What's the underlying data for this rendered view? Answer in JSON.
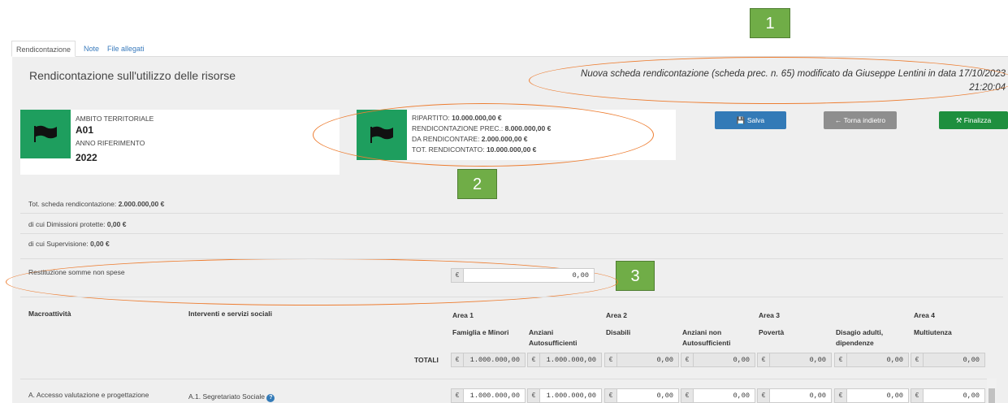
{
  "tabs": [
    "Rendicontazione",
    "Note",
    "File allegati"
  ],
  "page_title": "Rendicontazione sull'utilizzo delle risorse",
  "subtitle_line1": "Nuova scheda rendicontazione (scheda prec. n. 65) modificato da Giuseppe Lentini in data 17/10/2023",
  "subtitle_line2": "21:20:04",
  "card1": {
    "label1": "AMBITO TERRITORIALE",
    "value1": "A01",
    "label2": "ANNO RIFERIMENTO",
    "value2": "2022"
  },
  "card2": {
    "ripartito_label": "RIPARTITO: ",
    "ripartito_value": "10.000.000,00 €",
    "prec_label": "RENDICONTAZIONE PREC.: ",
    "prec_value": "8.000.000,00 €",
    "da_label": "DA RENDICONTARE: ",
    "da_value": "2.000.000,00 €",
    "tot_label": "TOT. RENDICONTATO: ",
    "tot_value": "10.000.000,00 €"
  },
  "buttons": {
    "save": "Salva",
    "back": "Torna indietro",
    "finalize": "Finalizza"
  },
  "badges": [
    "1",
    "2",
    "3"
  ],
  "summary": {
    "tot_label": "Tot. scheda rendicontazione: ",
    "tot_value": "2.000.000,00 €",
    "dimissioni_label": "di cui Dimissioni protette: ",
    "dimissioni_value": "0,00 €",
    "supervisione_label": "di cui Supervisione: ",
    "supervisione_value": "0,00 €"
  },
  "restituzione": {
    "label": "Restituzione somme non spese",
    "currency": "€",
    "value": "0,00"
  },
  "table": {
    "col_macro": "Macroattività",
    "col_interventi": "Interventi e servizi sociali",
    "areas": [
      "Area 1",
      "Area 2",
      "Area 3",
      "Area 4"
    ],
    "subcols": [
      "Famiglia e Minori",
      "Anziani Autosufficienti",
      "Disabili",
      "Anziani non Autosufficienti",
      "Povertà",
      "Disagio adulti, dipendenze",
      "Multiutenza"
    ],
    "totali_label": "TOTALI",
    "totali_values": [
      "1.000.000,00",
      "1.000.000,00",
      "0,00",
      "0,00",
      "0,00",
      "0,00",
      "0,00"
    ],
    "row1_macro": "A. Accesso valutazione e progettazione",
    "row1_intervento": "A.1. Segretariato Sociale",
    "row1_values": [
      "1.000.000,00",
      "1.000.000,00",
      "0,00",
      "0,00",
      "0,00",
      "0,00",
      "0,00"
    ]
  },
  "colors": {
    "flag_green": "#1e9e5e",
    "save_blue": "#337ab7",
    "back_gray": "#8e8e8e",
    "finalize_green": "#1e8f3e",
    "badge_green": "#70ad47",
    "annotation_orange": "#ed7d31"
  }
}
